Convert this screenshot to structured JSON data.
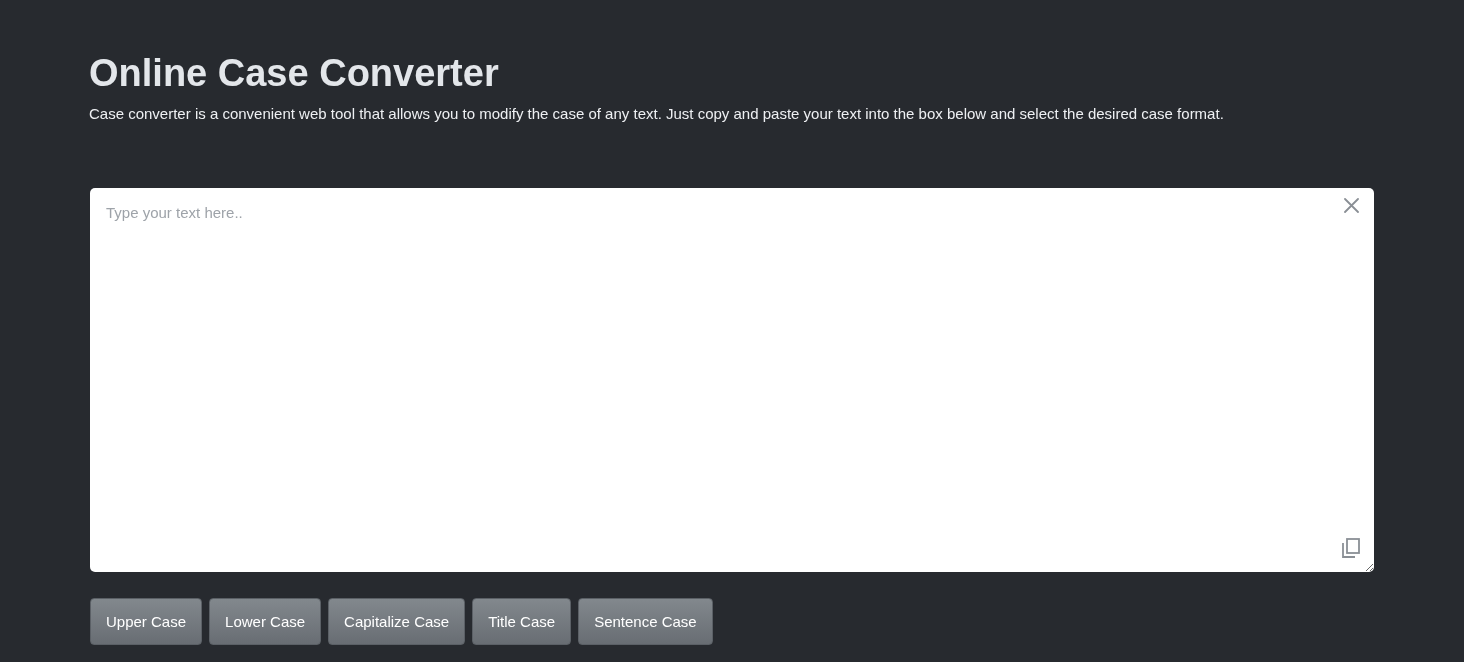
{
  "page": {
    "title": "Online Case Converter",
    "description": "Case converter is a convenient web tool that allows you to modify the case of any text. Just copy and paste your text into the box below and select the desired case format."
  },
  "editor": {
    "placeholder": "Type your text here.."
  },
  "buttons": [
    "Upper Case",
    "Lower Case",
    "Capitalize Case",
    "Title Case",
    "Sentence Case"
  ]
}
